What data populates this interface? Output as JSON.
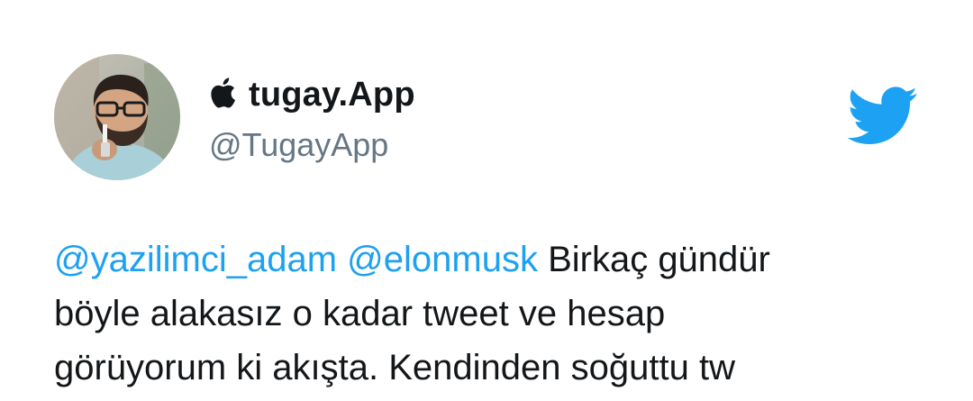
{
  "author": {
    "display_name": "tugay.App",
    "handle": "@TugayApp",
    "name_prefix_icon": "apple-logo-icon",
    "avatar_icon": "profile-photo"
  },
  "brand": {
    "logo_icon": "twitter-bird-icon",
    "accent_color": "#1da1f2"
  },
  "tweet": {
    "mentions": [
      "@yazilimci_adam",
      "@elonmusk"
    ],
    "line1_text": " Birkaç gündür",
    "line2_text": "böyle alakasız o kadar tweet ve hesap",
    "line3_text": "görüyorum ki akışta. Kendinden soğuttu tw"
  },
  "colors": {
    "text": "#14171a",
    "handle": "#657786",
    "mention": "#1da1f2",
    "background": "#ffffff"
  }
}
